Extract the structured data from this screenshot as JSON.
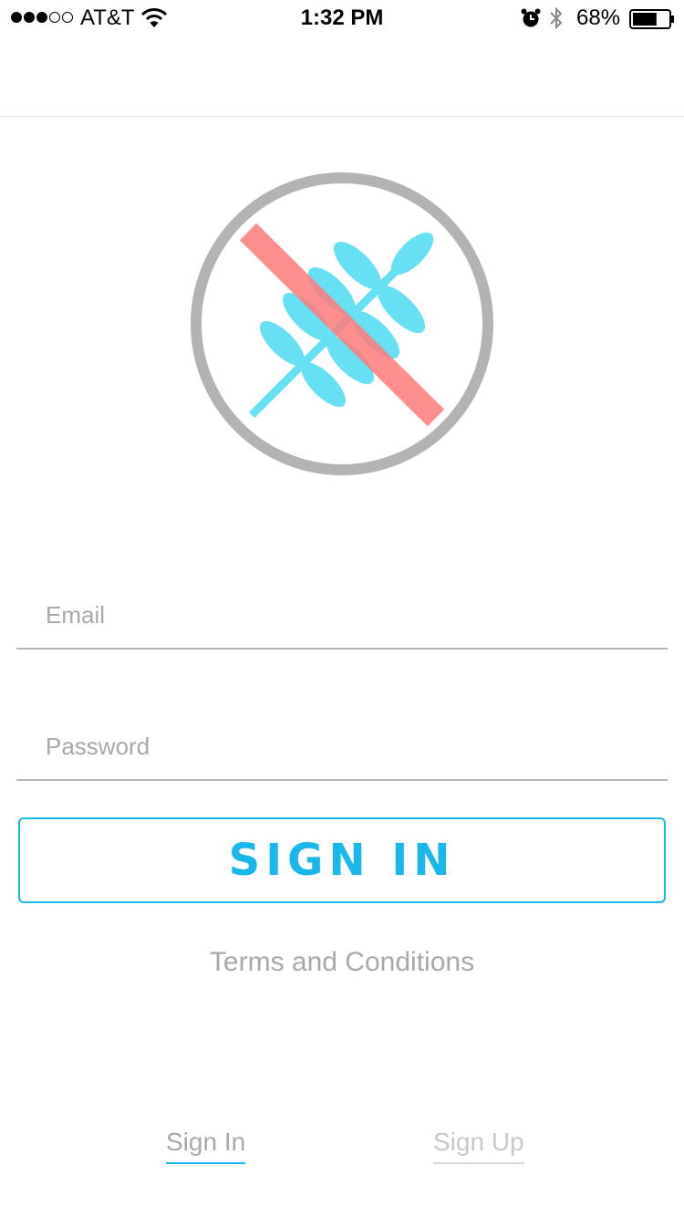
{
  "status_bar": {
    "carrier": "AT&T",
    "time": "1:32 PM",
    "battery_percent": "68%",
    "battery_level": 0.68,
    "signal_strength": 3,
    "signal_max": 5,
    "icons": [
      "wifi-icon",
      "alarm-icon",
      "bluetooth-icon",
      "battery-icon"
    ]
  },
  "logo": {
    "icon": "wheat-crossed-out-icon",
    "colors": {
      "ring": "#b3b3b3",
      "wheat": "#67e0f3",
      "cross": "#ff7b7b"
    }
  },
  "form": {
    "email_placeholder": "Email",
    "email_value": "",
    "password_placeholder": "Password",
    "password_value": "",
    "sign_in_label": "SIGN IN",
    "terms_label": "Terms and Conditions"
  },
  "tabs": [
    {
      "label": "Sign In",
      "active": true
    },
    {
      "label": "Sign Up",
      "active": false
    }
  ],
  "colors": {
    "accent": "#1ab7ea",
    "muted_text": "#a8a8a8",
    "divider": "#b5b5b5"
  }
}
